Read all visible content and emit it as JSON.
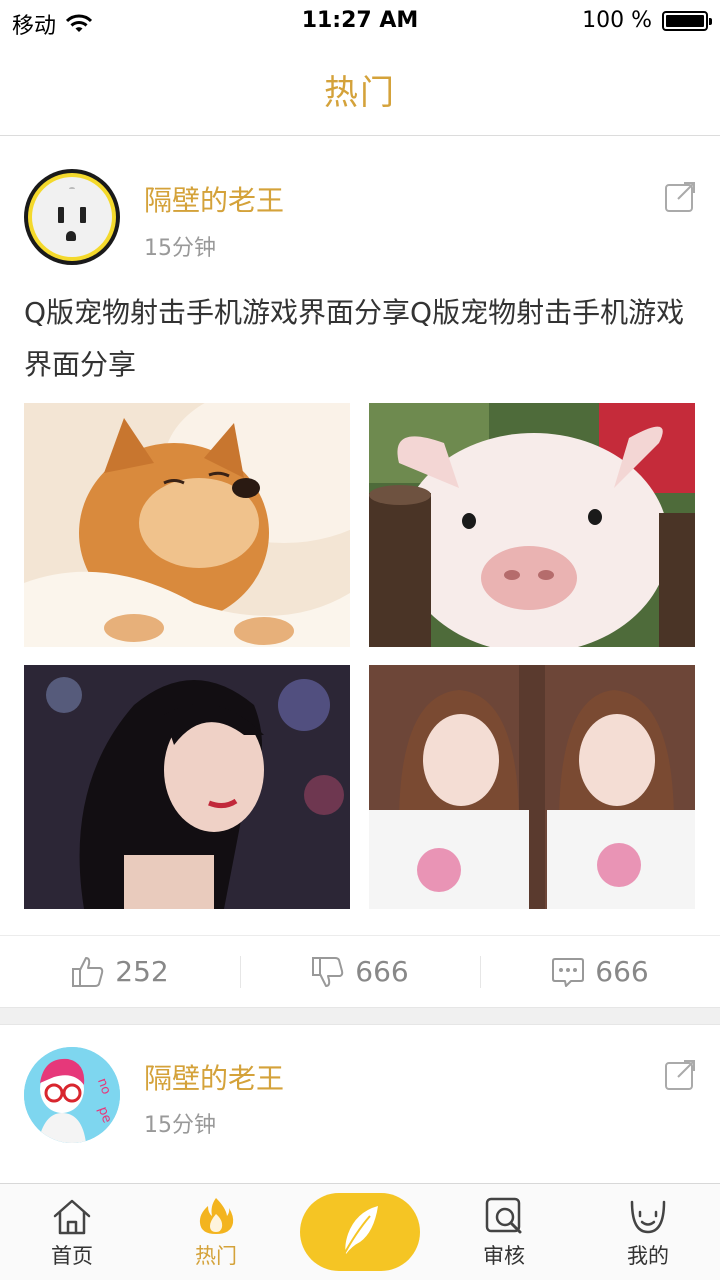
{
  "status_bar": {
    "carrier": "移动",
    "time": "11:27 AM",
    "battery_text": "100 %",
    "battery_level": 1.0
  },
  "nav": {
    "title": "热门"
  },
  "posts": [
    {
      "username": "隔壁的老王",
      "time": "15分钟",
      "text": "Q版宠物射击手机游戏界面分享Q版宠物射击手机游戏界面分享",
      "likes": "252",
      "dislikes": "666",
      "comments": "666"
    },
    {
      "username": "隔壁的老王",
      "time": "15分钟"
    }
  ],
  "tabs": [
    {
      "label": "首页",
      "icon": "home-icon"
    },
    {
      "label": "热门",
      "icon": "flame-icon"
    },
    {
      "label": "",
      "icon": "feather-icon"
    },
    {
      "label": "审核",
      "icon": "review-icon"
    },
    {
      "label": "我的",
      "icon": "smiley-icon"
    }
  ],
  "colors": {
    "accent": "#d4a23a",
    "post_button": "#f5c524"
  }
}
